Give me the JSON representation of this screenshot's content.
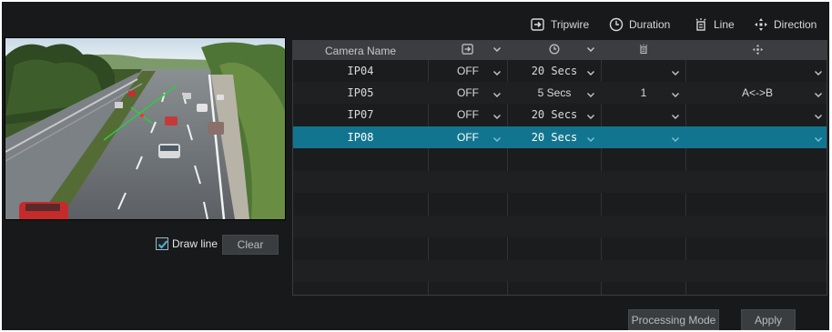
{
  "legend": {
    "tripwire": "Tripwire",
    "duration": "Duration",
    "line": "Line",
    "direction": "Direction"
  },
  "table": {
    "columns": {
      "camera_name": "Camera Name"
    },
    "rows": [
      {
        "camera": "IP04",
        "tripwire": "OFF",
        "duration": "20 Secs",
        "line": "",
        "direction": ""
      },
      {
        "camera": "IP05",
        "tripwire": "OFF",
        "duration": "5 Secs",
        "line": "1",
        "direction": "A<->B"
      },
      {
        "camera": "IP07",
        "tripwire": "OFF",
        "duration": "20 Secs",
        "line": "",
        "direction": ""
      },
      {
        "camera": "IP08",
        "tripwire": "OFF",
        "duration": "20 Secs",
        "line": "",
        "direction": ""
      }
    ]
  },
  "draw_line": {
    "label": "Draw line",
    "checked": true
  },
  "buttons": {
    "clear": "Clear",
    "processing_mode": "Processing Mode",
    "apply": "Apply"
  },
  "colors": {
    "selected_row": "#12758f",
    "background": "#18191b",
    "header": "#3b3d40",
    "tripwire_line": "#2ecc40"
  },
  "icons": {
    "tripwire": "tripwire-icon",
    "duration": "timer-icon",
    "line": "line-icon",
    "direction": "direction-arrows-icon",
    "dropdown": "chevron-down-icon"
  }
}
